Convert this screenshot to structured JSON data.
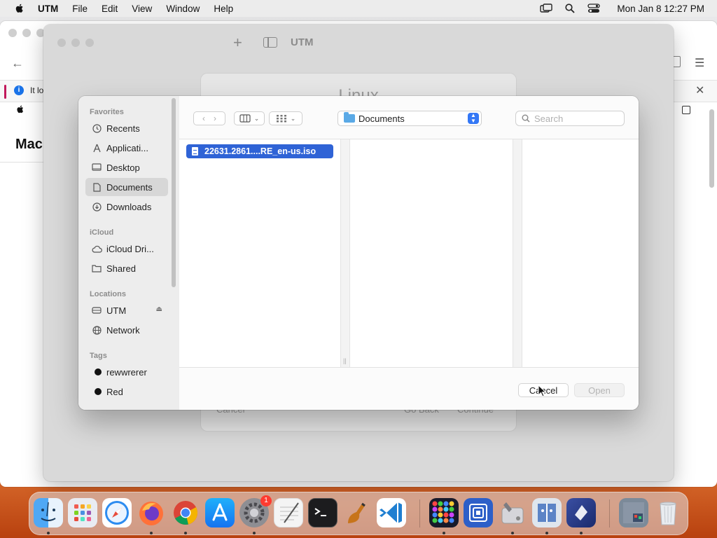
{
  "menubar": {
    "app_name": "UTM",
    "menus": [
      "File",
      "Edit",
      "View",
      "Window",
      "Help"
    ],
    "clock": "Mon Jan 8  12:27 PM",
    "icons": [
      "apple-icon",
      "window-switch-icon",
      "spotlight-icon",
      "control-center-icon"
    ]
  },
  "browser": {
    "info_text": "It lo",
    "heading": "Mac"
  },
  "utm_window": {
    "title": "UTM"
  },
  "wizard": {
    "title": "Linux",
    "cancel_label": "Cancel",
    "back_label": "Go Back",
    "continue_label": "Continue"
  },
  "dialog": {
    "sidebar": {
      "favorites_label": "Favorites",
      "favorites": [
        {
          "label": "Recents",
          "icon": "clock-icon"
        },
        {
          "label": "Applicati...",
          "icon": "applications-icon"
        },
        {
          "label": "Desktop",
          "icon": "desktop-icon"
        },
        {
          "label": "Documents",
          "icon": "document-icon",
          "selected": true
        },
        {
          "label": "Downloads",
          "icon": "download-icon"
        }
      ],
      "icloud_label": "iCloud",
      "icloud": [
        {
          "label": "iCloud Dri...",
          "icon": "cloud-icon"
        },
        {
          "label": "Shared",
          "icon": "shared-folder-icon"
        }
      ],
      "locations_label": "Locations",
      "locations": [
        {
          "label": "UTM",
          "icon": "disk-icon"
        },
        {
          "label": "Network",
          "icon": "globe-icon"
        }
      ],
      "tags_label": "Tags",
      "tags": [
        {
          "label": "rewwrerer",
          "color": "#111111"
        },
        {
          "label": "Red",
          "color": "#111111"
        }
      ]
    },
    "toolbar": {
      "location": "Documents",
      "search_placeholder": "Search"
    },
    "files": [
      "22631.2861....RE_en-us.iso"
    ],
    "buttons": {
      "cancel": "Cancel",
      "open": "Open"
    },
    "accent_color": "#2f63d6"
  },
  "dock": {
    "apps": [
      "Finder",
      "Launchpad",
      "Safari",
      "Firefox",
      "Chrome",
      "App Store",
      "System Settings",
      "TextEdit",
      "Terminal",
      "Instruments",
      "VS Code",
      "Game",
      "Screens",
      "Disk Utility",
      "Finder Helper",
      "Shortcut",
      "Downloads Stack",
      "Trash"
    ],
    "settings_badge": "1"
  }
}
